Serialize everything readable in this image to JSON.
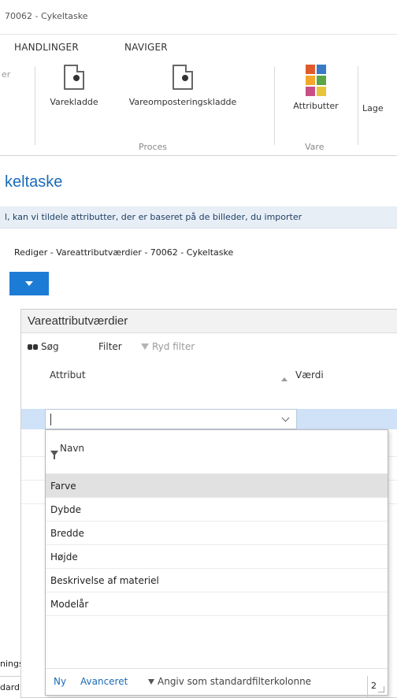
{
  "window": {
    "title": "70062 - Cykeltaske"
  },
  "menu": {
    "items": [
      "HANDLINGER",
      "NAVIGER"
    ]
  },
  "ribbon": {
    "cut_label": "er",
    "buttons": [
      {
        "label": "Varekladde",
        "icon": "document-icon"
      },
      {
        "label": "Vareomposteringskladde",
        "icon": "document-icon"
      },
      {
        "label": "Attributter",
        "icon": "attributes-icon"
      },
      {
        "label": "Lage",
        "icon": ""
      }
    ],
    "groups": [
      "Proces",
      "Vare"
    ]
  },
  "page": {
    "title": "keltaske"
  },
  "infobar": {
    "text": "l, kan vi tildele attributter, der er baseret på de billeder, du importer"
  },
  "dialog": {
    "title": "Rediger - Vareattributværdier - 70062 - Cykeltaske",
    "tab_color": "#1c7cd5",
    "panel": {
      "heading": "Vareattributværdier",
      "toolbar": {
        "search": "Søg",
        "filter": "Filter",
        "clear_filter": "Ryd filter"
      },
      "columns": [
        "Attribut",
        "Værdi"
      ],
      "input_value": ""
    },
    "dropdown": {
      "header": "Navn",
      "items": [
        "Farve",
        "Dybde",
        "Bredde",
        "Højde",
        "Beskrivelse af materiel",
        "Modelår"
      ],
      "selected": "Farve",
      "footer": {
        "new": "Ny",
        "advanced": "Avanceret",
        "set_default": "Angiv som standardfilterkolonne"
      }
    }
  },
  "background": {
    "label1": "ningsr",
    "label2": "dard):",
    "box_value": "2"
  },
  "colors": {
    "accent": "#1b6bb8",
    "selected_row": "#cfe2f7",
    "infobar": "#e7eef6"
  }
}
